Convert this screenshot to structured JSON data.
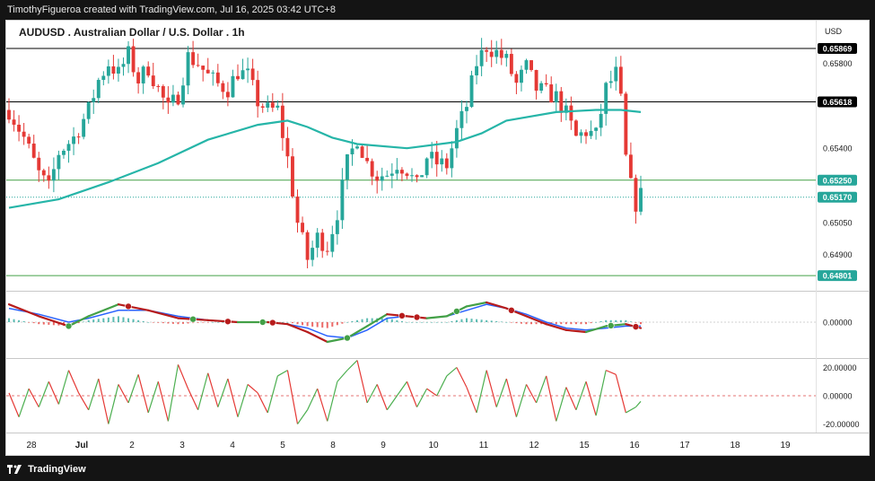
{
  "header": {
    "credit": "TimothyFigueroa created with TradingView.com, Jul 16, 2025 03:42 UTC+8"
  },
  "footer": {
    "brand": "TradingView"
  },
  "colors": {
    "up": "#26a69a",
    "down": "#e53935",
    "ma": "#26b5a8",
    "hline": "#000000",
    "supportLine": "#43a047",
    "lastPrice": "#26a69a",
    "rsiUp": "#4caf50",
    "rsiDown": "#e53935",
    "macdBlue": "#2962ff",
    "macdGreen": "#43a047",
    "macdRed": "#b71c1c"
  },
  "chart_data": {
    "type": "candlestick",
    "title": "AUDUSD . Australian Dollar / U.S. Dollar . 1h",
    "currency": "USD",
    "x_labels": [
      "28",
      "Jul",
      "2",
      "3",
      "4",
      "5",
      "8",
      "9",
      "10",
      "11",
      "12",
      "15",
      "16",
      "17",
      "18",
      "19"
    ],
    "y_ticks": [
      "0.65800",
      "0.65400",
      "0.65050",
      "0.64900"
    ],
    "y_range": [
      0.6473,
      0.66
    ],
    "horizontal_levels": [
      {
        "label": "0.65869",
        "value": 0.65869,
        "style": "resistance"
      },
      {
        "label": "0.65618",
        "value": 0.65618,
        "style": "resistance"
      },
      {
        "label": "0.65250",
        "value": 0.6525,
        "style": "support"
      },
      {
        "label": "0.64801",
        "value": 0.64801,
        "style": "support"
      }
    ],
    "last_price": {
      "label": "0.65170",
      "value": 0.6517
    },
    "price_path": [
      [
        0,
        0.6558
      ],
      [
        3,
        0.6545
      ],
      [
        6,
        0.6528
      ],
      [
        8,
        0.6521
      ],
      [
        10,
        0.6538
      ],
      [
        13,
        0.6545
      ],
      [
        16,
        0.6558
      ],
      [
        18,
        0.6572
      ],
      [
        20,
        0.658
      ],
      [
        22,
        0.6575
      ],
      [
        24,
        0.6584
      ],
      [
        26,
        0.6572
      ],
      [
        28,
        0.6578
      ],
      [
        30,
        0.6568
      ],
      [
        32,
        0.6558
      ],
      [
        34,
        0.6565
      ],
      [
        36,
        0.6583
      ],
      [
        38,
        0.658
      ],
      [
        40,
        0.6574
      ],
      [
        42,
        0.657
      ],
      [
        44,
        0.6568
      ],
      [
        46,
        0.6576
      ],
      [
        48,
        0.6574
      ],
      [
        50,
        0.6562
      ],
      [
        52,
        0.6558
      ],
      [
        54,
        0.6558
      ],
      [
        56,
        0.6535
      ],
      [
        58,
        0.6505
      ],
      [
        60,
        0.6488
      ],
      [
        62,
        0.6498
      ],
      [
        64,
        0.6494
      ],
      [
        66,
        0.651
      ],
      [
        68,
        0.6533
      ],
      [
        70,
        0.6545
      ],
      [
        72,
        0.6533
      ],
      [
        74,
        0.6527
      ],
      [
        76,
        0.6528
      ],
      [
        78,
        0.6533
      ],
      [
        80,
        0.653
      ],
      [
        82,
        0.6522
      ],
      [
        84,
        0.6536
      ],
      [
        86,
        0.6533
      ],
      [
        88,
        0.6532
      ],
      [
        90,
        0.6548
      ],
      [
        92,
        0.656
      ],
      [
        94,
        0.658
      ],
      [
        96,
        0.6588
      ],
      [
        98,
        0.6585
      ],
      [
        100,
        0.6581
      ],
      [
        102,
        0.657
      ],
      [
        104,
        0.6578
      ],
      [
        106,
        0.6568
      ],
      [
        108,
        0.6566
      ],
      [
        110,
        0.6564
      ],
      [
        112,
        0.6556
      ],
      [
        114,
        0.6545
      ],
      [
        116,
        0.6548
      ],
      [
        118,
        0.6546
      ],
      [
        120,
        0.6568
      ],
      [
        122,
        0.6575
      ],
      [
        123,
        0.6562
      ],
      [
        124,
        0.6535
      ],
      [
        125,
        0.6522
      ],
      [
        126,
        0.6514
      ],
      [
        127,
        0.6518
      ]
    ],
    "ma_series": [
      [
        0,
        0.6512
      ],
      [
        10,
        0.6516
      ],
      [
        20,
        0.6524
      ],
      [
        30,
        0.6533
      ],
      [
        40,
        0.6544
      ],
      [
        50,
        0.6551
      ],
      [
        56,
        0.6553
      ],
      [
        60,
        0.655
      ],
      [
        65,
        0.6545
      ],
      [
        70,
        0.6542
      ],
      [
        80,
        0.654
      ],
      [
        90,
        0.6543
      ],
      [
        95,
        0.6547
      ],
      [
        100,
        0.6553
      ],
      [
        110,
        0.6557
      ],
      [
        118,
        0.6558
      ],
      [
        123,
        0.6558
      ],
      [
        127,
        0.6557
      ]
    ],
    "macd_panel": {
      "y_ticks": [
        "0.00000"
      ],
      "fast": [
        [
          0,
          0.9
        ],
        [
          6,
          0.3
        ],
        [
          12,
          -0.2
        ],
        [
          16,
          0.3
        ],
        [
          22,
          0.9
        ],
        [
          28,
          0.6
        ],
        [
          34,
          0.2
        ],
        [
          40,
          0.1
        ],
        [
          46,
          0.0
        ],
        [
          52,
          0.0
        ],
        [
          56,
          -0.1
        ],
        [
          60,
          -0.5
        ],
        [
          64,
          -1.0
        ],
        [
          68,
          -0.8
        ],
        [
          72,
          -0.2
        ],
        [
          76,
          0.4
        ],
        [
          80,
          0.3
        ],
        [
          84,
          0.2
        ],
        [
          88,
          0.3
        ],
        [
          92,
          0.8
        ],
        [
          96,
          1.0
        ],
        [
          100,
          0.7
        ],
        [
          104,
          0.3
        ],
        [
          108,
          -0.1
        ],
        [
          112,
          -0.4
        ],
        [
          116,
          -0.5
        ],
        [
          120,
          -0.2
        ],
        [
          124,
          -0.1
        ],
        [
          127,
          -0.3
        ]
      ],
      "signal": [
        [
          0,
          0.7
        ],
        [
          6,
          0.4
        ],
        [
          12,
          0.0
        ],
        [
          16,
          0.2
        ],
        [
          22,
          0.6
        ],
        [
          28,
          0.6
        ],
        [
          34,
          0.3
        ],
        [
          40,
          0.1
        ],
        [
          46,
          0.0
        ],
        [
          52,
          0.0
        ],
        [
          56,
          -0.1
        ],
        [
          60,
          -0.3
        ],
        [
          64,
          -0.7
        ],
        [
          68,
          -0.8
        ],
        [
          72,
          -0.4
        ],
        [
          76,
          0.2
        ],
        [
          80,
          0.3
        ],
        [
          84,
          0.2
        ],
        [
          88,
          0.3
        ],
        [
          92,
          0.6
        ],
        [
          96,
          0.9
        ],
        [
          100,
          0.7
        ],
        [
          104,
          0.4
        ],
        [
          108,
          0.0
        ],
        [
          112,
          -0.3
        ],
        [
          116,
          -0.4
        ],
        [
          120,
          -0.3
        ],
        [
          124,
          -0.2
        ],
        [
          127,
          -0.2
        ]
      ],
      "cross_markers": [
        {
          "x": 12,
          "kind": "bullish"
        },
        {
          "x": 24,
          "kind": "bearish"
        },
        {
          "x": 37,
          "kind": "bullish"
        },
        {
          "x": 44,
          "kind": "bearish"
        },
        {
          "x": 51,
          "kind": "bullish"
        },
        {
          "x": 53,
          "kind": "bearish"
        },
        {
          "x": 68,
          "kind": "bullish"
        },
        {
          "x": 79,
          "kind": "bearish"
        },
        {
          "x": 82,
          "kind": "bearish"
        },
        {
          "x": 90,
          "kind": "bullish"
        },
        {
          "x": 101,
          "kind": "bearish"
        },
        {
          "x": 121,
          "kind": "bullish"
        },
        {
          "x": 126,
          "kind": "bearish"
        }
      ]
    },
    "oscillator_panel": {
      "y_ticks": [
        "20.00000",
        "0.00000",
        "-20.00000"
      ],
      "y_range": [
        -26,
        26
      ],
      "values": [
        [
          0,
          2
        ],
        [
          2,
          -15
        ],
        [
          4,
          5
        ],
        [
          6,
          -8
        ],
        [
          8,
          10
        ],
        [
          10,
          -6
        ],
        [
          12,
          18
        ],
        [
          14,
          2
        ],
        [
          16,
          -10
        ],
        [
          18,
          12
        ],
        [
          20,
          -20
        ],
        [
          22,
          8
        ],
        [
          24,
          -5
        ],
        [
          26,
          15
        ],
        [
          28,
          -12
        ],
        [
          30,
          10
        ],
        [
          32,
          -18
        ],
        [
          34,
          22
        ],
        [
          36,
          5
        ],
        [
          38,
          -10
        ],
        [
          40,
          16
        ],
        [
          42,
          -8
        ],
        [
          44,
          12
        ],
        [
          46,
          -15
        ],
        [
          48,
          8
        ],
        [
          50,
          2
        ],
        [
          52,
          -12
        ],
        [
          54,
          14
        ],
        [
          56,
          18
        ],
        [
          58,
          -20
        ],
        [
          60,
          -10
        ],
        [
          62,
          5
        ],
        [
          64,
          -18
        ],
        [
          66,
          10
        ],
        [
          68,
          18
        ],
        [
          70,
          25
        ],
        [
          72,
          -5
        ],
        [
          74,
          8
        ],
        [
          76,
          -10
        ],
        [
          78,
          0
        ],
        [
          80,
          10
        ],
        [
          82,
          -8
        ],
        [
          84,
          5
        ],
        [
          86,
          0
        ],
        [
          88,
          14
        ],
        [
          90,
          20
        ],
        [
          92,
          6
        ],
        [
          94,
          -12
        ],
        [
          96,
          18
        ],
        [
          98,
          -8
        ],
        [
          100,
          12
        ],
        [
          102,
          -15
        ],
        [
          104,
          8
        ],
        [
          106,
          -5
        ],
        [
          108,
          14
        ],
        [
          110,
          -18
        ],
        [
          112,
          6
        ],
        [
          114,
          -10
        ],
        [
          116,
          10
        ],
        [
          118,
          -14
        ],
        [
          120,
          18
        ],
        [
          122,
          15
        ],
        [
          124,
          -12
        ],
        [
          126,
          -8
        ],
        [
          127,
          -4
        ]
      ]
    }
  }
}
